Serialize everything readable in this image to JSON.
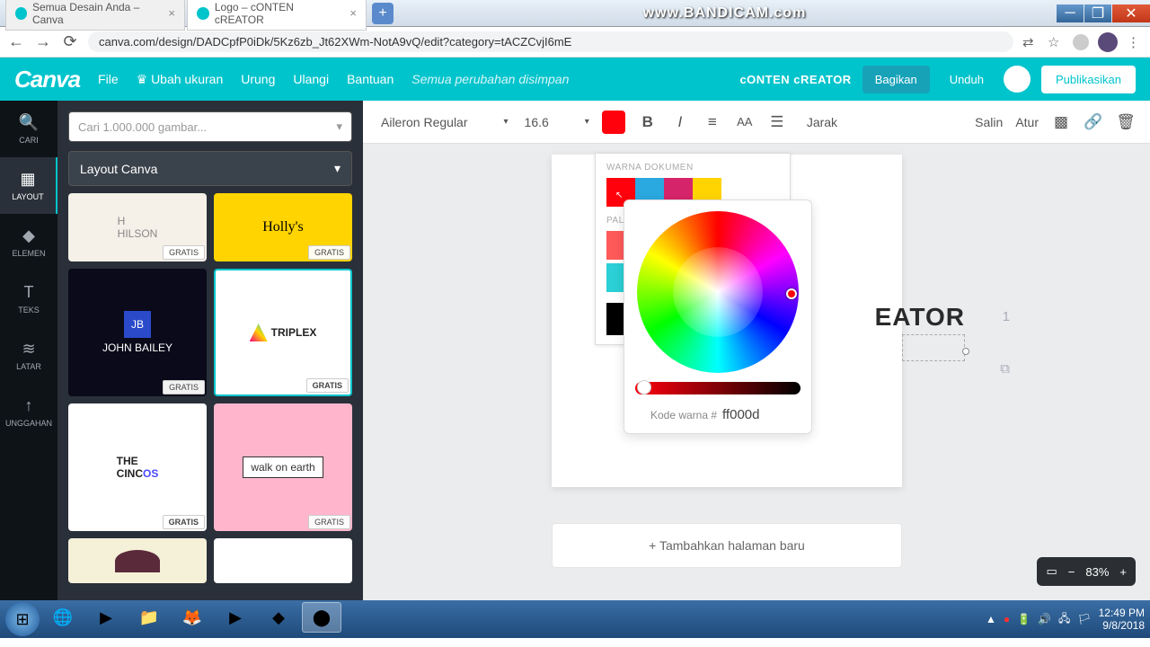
{
  "browser": {
    "tabs": [
      {
        "title": "Semua Desain Anda – Canva"
      },
      {
        "title": "Logo – cONTEN cREATOR"
      }
    ],
    "watermark": "www.BANDICAM.com",
    "url": "canva.com/design/DADCpfP0iDk/5Kz6zb_Jt62XWm-NotA9vQ/edit?category=tACZCvjI6mE"
  },
  "header": {
    "logo": "Canva",
    "menu": [
      "File",
      "Ubah ukuran",
      "Urung",
      "Ulangi",
      "Bantuan"
    ],
    "saved": "Semua perubahan disimpan",
    "filename": "cONTEN cREATOR",
    "share": "Bagikan",
    "download": "Unduh",
    "publish": "Publikasikan"
  },
  "nav": [
    {
      "icon": "🔍",
      "label": "CARI"
    },
    {
      "icon": "▦",
      "label": "LAYOUT"
    },
    {
      "icon": "◆",
      "label": "ELEMEN"
    },
    {
      "icon": "T",
      "label": "TEKS"
    },
    {
      "icon": "≋",
      "label": "LATAR"
    },
    {
      "icon": "↑",
      "label": "UNGGAHAN"
    }
  ],
  "panel": {
    "search_placeholder": "Cari 1.000.000 gambar...",
    "layout_label": "Layout Canva",
    "free": "GRATIS"
  },
  "toolbar": {
    "font": "Aileron Regular",
    "size": "16.6",
    "jarak": "Jarak",
    "salin": "Salin",
    "atur": "Atur"
  },
  "colorpicker": {
    "warna_dokumen": "WARNA DOKUMEN",
    "palet": "PALET",
    "doc_colors": [
      "#ff000d",
      "#2aa8e0",
      "#d6246a",
      "#ffd400"
    ],
    "palet_colors": [
      "#ff5a5a",
      "#2ad0d6"
    ],
    "black": "#000000",
    "hex_label": "Kode warna #",
    "hex_value": "ff000d"
  },
  "canvas": {
    "visible_text": "EATOR",
    "page_num": "1",
    "add_page": "+ Tambahkan halaman baru"
  },
  "zoom": "83%",
  "taskbar": {
    "time": "12:49 PM",
    "date": "9/8/2018"
  }
}
